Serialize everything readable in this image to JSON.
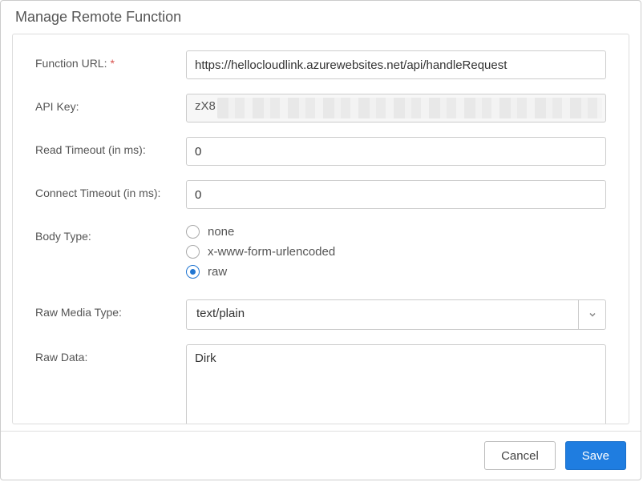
{
  "dialog": {
    "title": "Manage Remote Function"
  },
  "labels": {
    "function_url": "Function URL:",
    "api_key": "API Key:",
    "read_timeout": "Read Timeout (in ms):",
    "connect_timeout": "Connect Timeout (in ms):",
    "body_type": "Body Type:",
    "raw_media_type": "Raw Media Type:",
    "raw_data": "Raw Data:"
  },
  "values": {
    "function_url": "https://hellocloudlink.azurewebsites.net/api/handleRequest",
    "api_key_visible": "zX8",
    "read_timeout": "0",
    "connect_timeout": "0",
    "raw_media_type": "text/plain",
    "raw_data": "Dirk"
  },
  "body_type_options": {
    "none": "none",
    "form": "x-www-form-urlencoded",
    "raw": "raw",
    "selected": "raw"
  },
  "buttons": {
    "cancel": "Cancel",
    "save": "Save"
  }
}
